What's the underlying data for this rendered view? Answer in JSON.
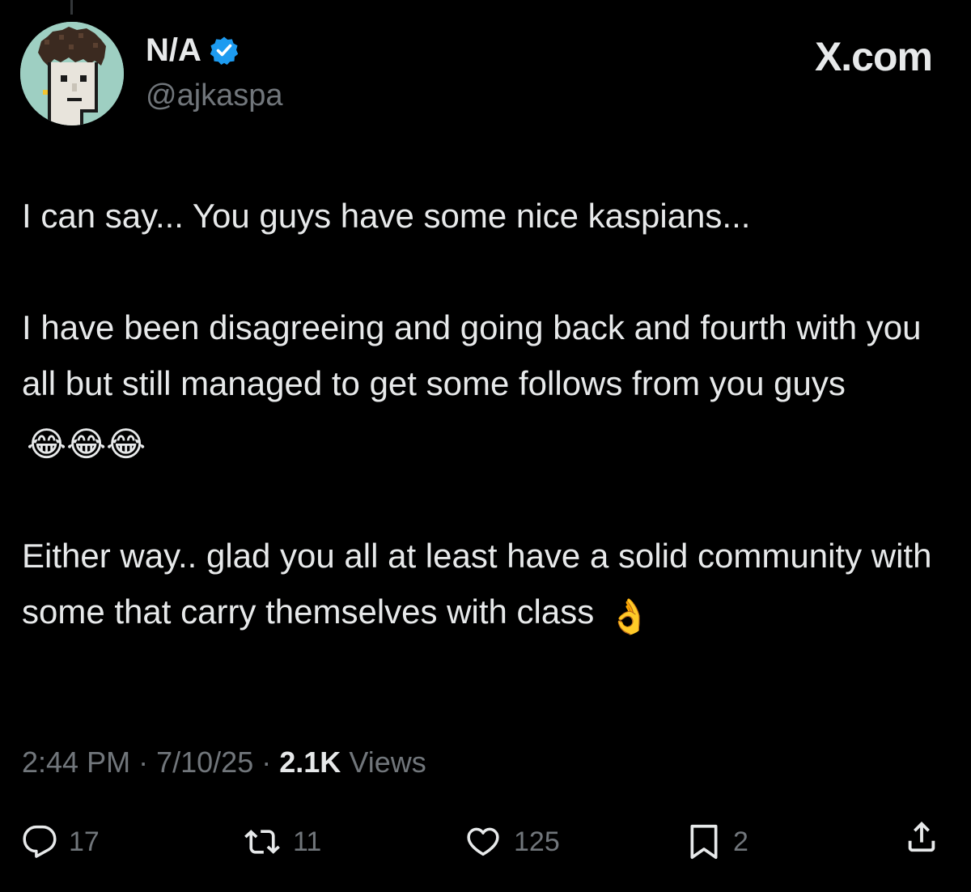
{
  "post": {
    "author": {
      "display_name": "N/A",
      "handle": "@ajkaspa",
      "verified": true,
      "avatar_icon": "pixel-punk-avatar"
    },
    "brand": "X.com",
    "paragraphs": [
      {
        "text": "I can say... You guys have some nice kaspians..."
      },
      {
        "text": "I have been disagreeing and going back and fourth with you all but still managed to get some follows from you guys",
        "emoji": "😂😂😂"
      },
      {
        "text": "Either way.. glad you all at least have a solid community with some that carry themselves with class",
        "emoji": "👌"
      }
    ],
    "meta": {
      "time": "2:44 PM",
      "separator": "·",
      "date": "7/10/25",
      "views_count": "2.1K",
      "views_label": "Views"
    },
    "actions": {
      "replies": "17",
      "reposts": "11",
      "likes": "125",
      "bookmarks": "2"
    }
  },
  "colors": {
    "background": "#000000",
    "text_primary": "#e7e9ea",
    "text_secondary": "#71767b",
    "verified_blue": "#1d9bf0"
  }
}
